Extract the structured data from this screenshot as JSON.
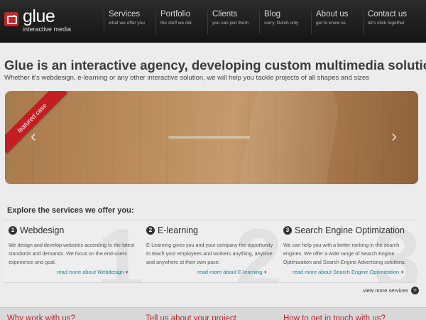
{
  "brand": {
    "name": "glue",
    "tagline": "interactive media"
  },
  "nav": [
    {
      "label": "Services",
      "sub": "what we offer you"
    },
    {
      "label": "Portfolio",
      "sub": "the stuff we did"
    },
    {
      "label": "Clients",
      "sub": "you can join them"
    },
    {
      "label": "Blog",
      "sub": "sorry, Dutch only"
    },
    {
      "label": "About us",
      "sub": "get to know us"
    },
    {
      "label": "Contact us",
      "sub": "let's stick together"
    }
  ],
  "intro": {
    "headline": "Glue is an interactive agency, developing custom multimedia solutions",
    "subline": "Whether it's webdesign, e-learning or any other interactive solution, we will help you tackle projects of all shapes and sizes"
  },
  "slider": {
    "ribbon": "featured case",
    "prev_icon": "‹",
    "next_icon": "›"
  },
  "services": {
    "title": "Explore the services we offer you:",
    "items": [
      {
        "num": "1",
        "title": "Webdesign",
        "text": "We design and develop websites according to the latest standards and demands. We focus on the end-users experience and goal.",
        "link": "read more about Webdesign"
      },
      {
        "num": "2",
        "title": "E-learning",
        "text": "E-Learning gives you and your company the opportunity to teach your employees and workers anything, anytime and anywhere at their own pace.",
        "link": "read more about E-learning"
      },
      {
        "num": "3",
        "title": "Search Engine Optimization",
        "text": "We can help you with a better ranking in the search engines. We offer a wide range of Search Engine Optimization and Search Engine Advertising solutions.",
        "link": "read more about Search Engine Optimization"
      }
    ],
    "view_more": "view more services"
  },
  "footer": {
    "col1": "Why work with us?",
    "col2": "Tell us about your project",
    "col3": "How to get in touch with us?"
  },
  "colors": {
    "accent": "#c0262a",
    "link": "#2a7f98"
  }
}
